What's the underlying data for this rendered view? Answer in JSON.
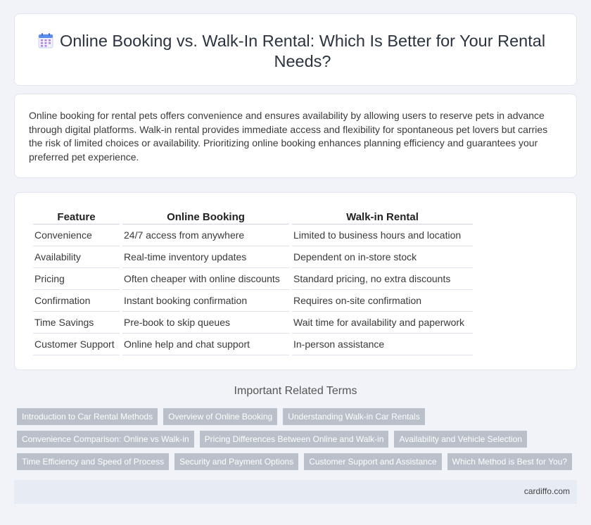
{
  "header": {
    "title": "Online Booking vs. Walk-In Rental: Which Is Better for Your Rental Needs?",
    "icon": "calendar-icon"
  },
  "intro": {
    "text": "Online booking for rental pets offers convenience and ensures availability by allowing users to reserve pets in advance through digital platforms. Walk-in rental provides immediate access and flexibility for spontaneous pet lovers but carries the risk of limited choices or availability. Prioritizing online booking enhances planning efficiency and guarantees your preferred pet experience."
  },
  "table": {
    "headers": [
      "Feature",
      "Online Booking",
      "Walk-in Rental"
    ],
    "rows": [
      [
        "Convenience",
        "24/7 access from anywhere",
        "Limited to business hours and location"
      ],
      [
        "Availability",
        "Real-time inventory updates",
        "Dependent on in-store stock"
      ],
      [
        "Pricing",
        "Often cheaper with online discounts",
        "Standard pricing, no extra discounts"
      ],
      [
        "Confirmation",
        "Instant booking confirmation",
        "Requires on-site confirmation"
      ],
      [
        "Time Savings",
        "Pre-book to skip queues",
        "Wait time for availability and paperwork"
      ],
      [
        "Customer Support",
        "Online help and chat support",
        "In-person assistance"
      ]
    ]
  },
  "related": {
    "heading": "Important Related Terms",
    "rows": [
      [
        "Introduction to Car Rental Methods",
        "Overview of Online Booking",
        "Understanding Walk-in Car Rentals"
      ],
      [
        "Convenience Comparison: Online vs Walk-in",
        "Pricing Differences Between Online and Walk-in",
        "Availability and Vehicle Selection"
      ],
      [
        "Time Efficiency and Speed of Process",
        "Security and Payment Options",
        "Customer Support and Assistance",
        "Which Method is Best for You?"
      ]
    ]
  },
  "footer": {
    "site": "cardiffo.com"
  },
  "colors": {
    "background": "#f1f3f8",
    "tag": "#b9c0ca",
    "footer": "#e6ebf4",
    "calendar_top": "#5b8def",
    "calendar_dots": "#b07fe0"
  }
}
